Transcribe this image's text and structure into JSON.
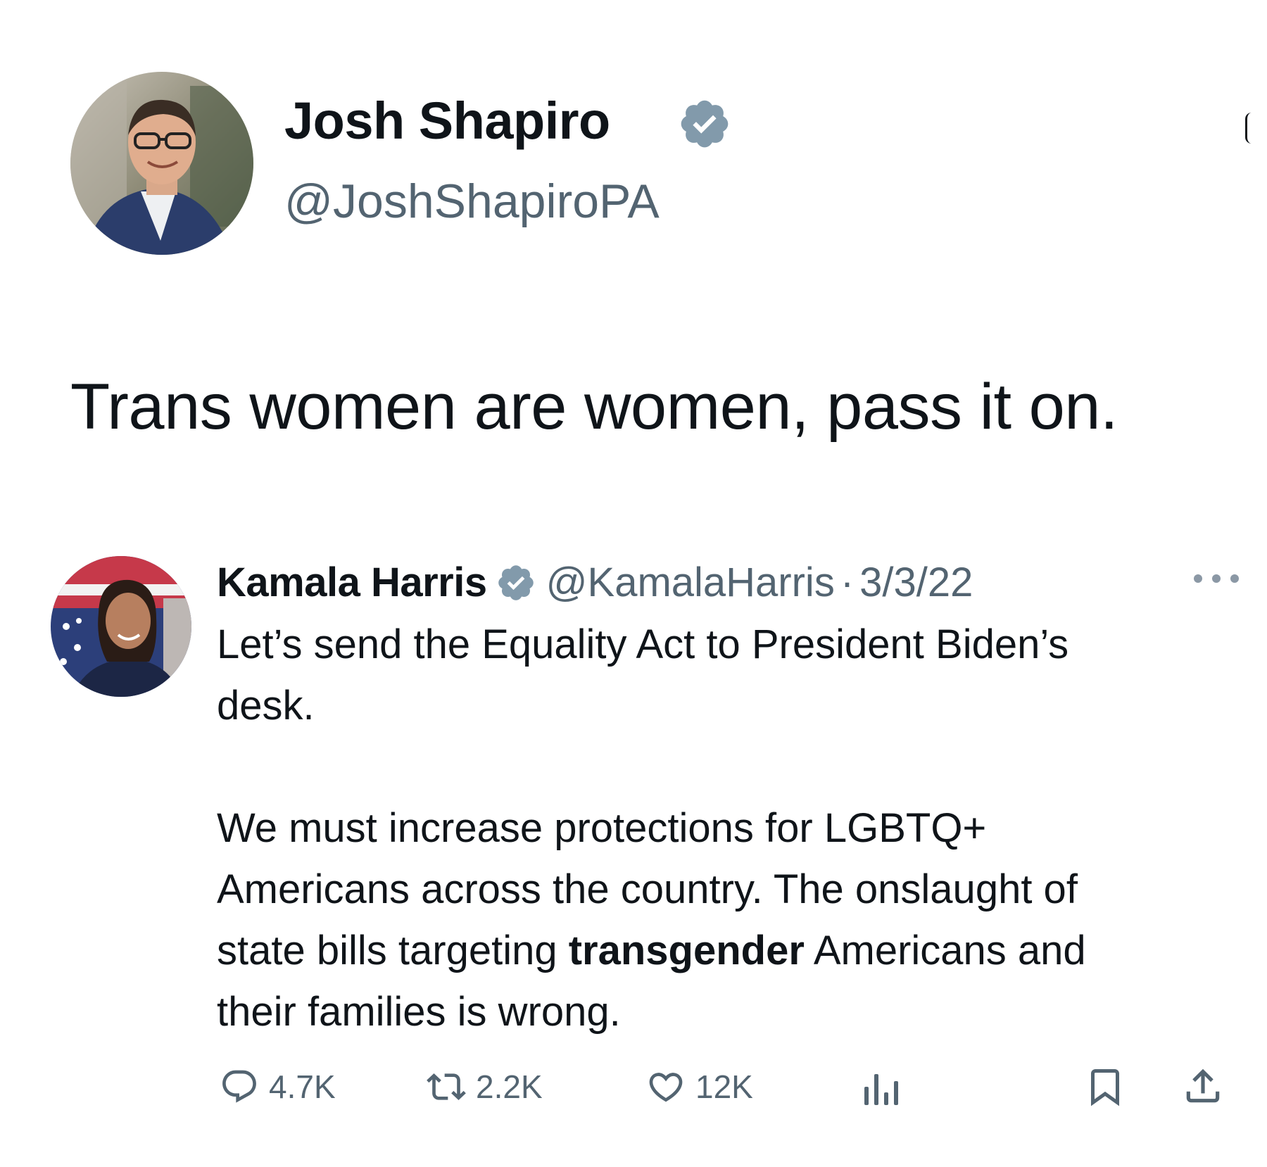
{
  "main_tweet": {
    "author": {
      "name": "Josh Shapiro",
      "handle": "@JoshShapiroPA",
      "verified": true,
      "avatar": "person-photo"
    },
    "text": "Trans women are women, pass it on."
  },
  "quoted_tweet": {
    "author": {
      "name": "Kamala Harris",
      "handle": "@KamalaHarris",
      "verified": true,
      "avatar": "person-photo"
    },
    "separator": "·",
    "date": "3/3/22",
    "more_icon": "more-horizontal-icon",
    "paragraph1": {
      "line1": "Let’s send the Equality Act to President Biden’s",
      "line2": "desk."
    },
    "paragraph2": {
      "line1": "We must increase protections for LGBTQ+",
      "line2": "Americans across the country. The onslaught of",
      "line3_before": "state bills targeting ",
      "line3_bold": "transgender",
      "line3_after": " Americans and",
      "line4": "their families is wrong."
    }
  },
  "actions": {
    "reply": {
      "icon": "reply-icon",
      "count": "4.7K"
    },
    "retweet": {
      "icon": "retweet-icon",
      "count": "2.2K"
    },
    "like": {
      "icon": "heart-icon",
      "count": "12K"
    },
    "views": {
      "icon": "analytics-icon"
    },
    "bookmark": {
      "icon": "bookmark-icon"
    },
    "share": {
      "icon": "share-icon"
    }
  },
  "colors": {
    "text": "#0f1419",
    "secondary_text": "#536471",
    "verified_badge": "#829aab",
    "background": "#ffffff"
  }
}
